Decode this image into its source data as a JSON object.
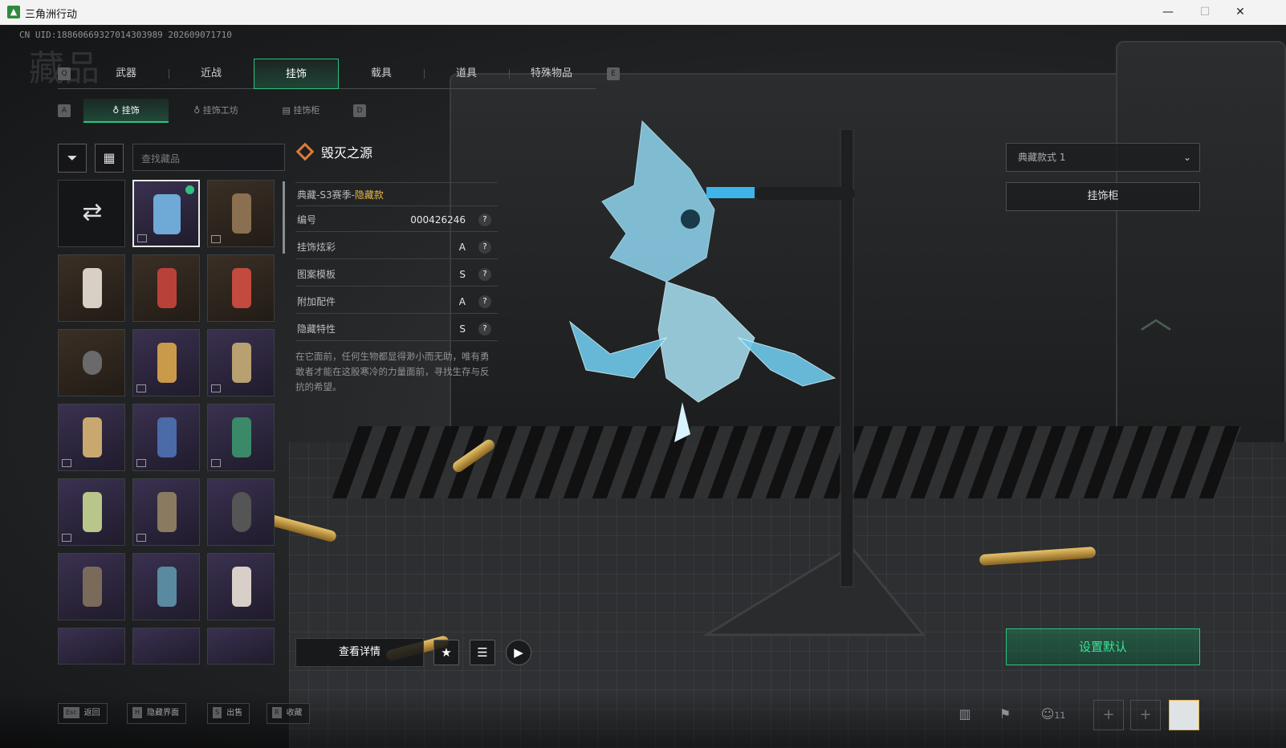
{
  "window": {
    "title": "三角洲行动",
    "min": "—",
    "max": "☐",
    "close": "✕"
  },
  "uid": "CN UID:18860669327014303989 202609071710",
  "bg_title": "藏品",
  "tabs": {
    "left_key": "Q",
    "right_key": "E",
    "items": [
      {
        "label": "武器"
      },
      {
        "label": "近战"
      },
      {
        "label": "挂饰"
      },
      {
        "label": "载具"
      },
      {
        "label": "道具"
      },
      {
        "label": "特殊物品"
      }
    ],
    "active": 2
  },
  "subtabs": {
    "left_key": "A",
    "right_key": "D",
    "items": [
      {
        "label": "挂饰"
      },
      {
        "label": "挂饰工坊"
      },
      {
        "label": "挂饰柜"
      }
    ]
  },
  "search": {
    "placeholder": "查找藏品"
  },
  "item": {
    "name": "毁灭之源",
    "series": "典藏-S3赛季-",
    "rarity": "隐藏款",
    "rows": [
      {
        "label": "编号",
        "value": "000426246"
      },
      {
        "label": "挂饰炫彩",
        "value": "A"
      },
      {
        "label": "图案模板",
        "value": "S"
      },
      {
        "label": "附加配件",
        "value": "A"
      },
      {
        "label": "隐藏特性",
        "value": "S"
      }
    ],
    "help": "?",
    "description": "在它面前，任何生物都显得渺小而无助，唯有勇敢者才能在这股寒冷的力量面前，寻找生存与反抗的希望。"
  },
  "right": {
    "style_select": "典藏款式 1",
    "cabinet_button": "挂饰柜",
    "set_default": "设置默认"
  },
  "actions": {
    "detail": "查看详情",
    "star": "★",
    "list": "☰",
    "play": "▶"
  },
  "hotkeys": [
    {
      "key": "Esc",
      "label": "返回"
    },
    {
      "key": "H",
      "label": "隐藏界面"
    },
    {
      "key": "S",
      "label": "出售"
    },
    {
      "key": "R",
      "label": "收藏"
    }
  ],
  "status": {
    "friends": "11"
  },
  "colors": {
    "accent": "#2fc27f",
    "rarity": "#e8b84a",
    "diamond": "#e07a3a"
  }
}
